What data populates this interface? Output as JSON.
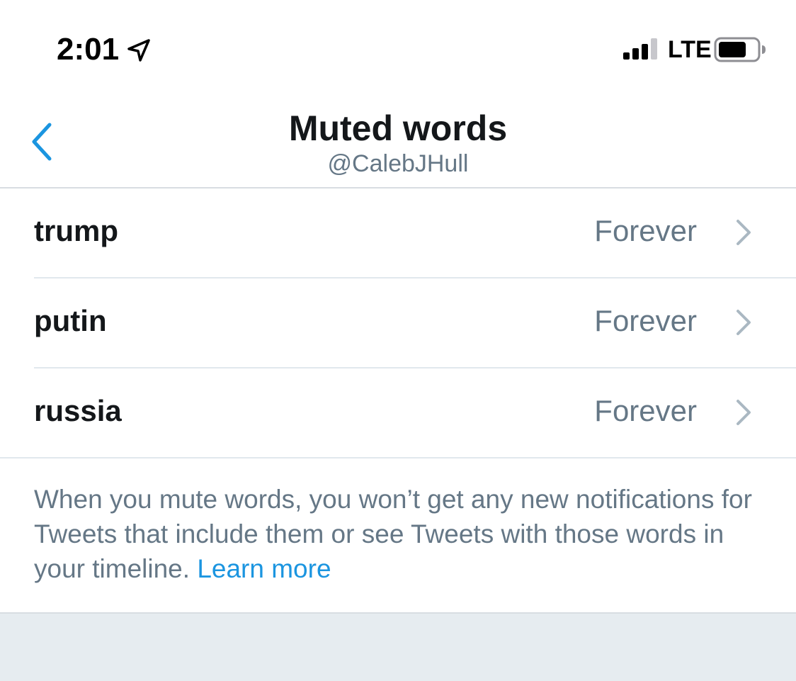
{
  "status_bar": {
    "time": "2:01",
    "network": "LTE",
    "icons": [
      "location-arrow-icon",
      "cellular-signal-icon",
      "battery-icon"
    ]
  },
  "header": {
    "title": "Muted words",
    "subtitle": "@CalebJHull",
    "back_icon": "chevron-left-icon"
  },
  "muted_words": [
    {
      "word": "trump",
      "duration": "Forever"
    },
    {
      "word": "putin",
      "duration": "Forever"
    },
    {
      "word": "russia",
      "duration": "Forever"
    }
  ],
  "explanation": {
    "text": "When you mute words, you won’t get any new notifications for Tweets that include them or see Tweets with those words in your timeline.",
    "link_label": "Learn more"
  },
  "colors": {
    "accent": "#1b95e0",
    "text_primary": "#14171a",
    "text_secondary": "#657786",
    "divider": "#e1e8ed",
    "background_gray": "#e6ecf0"
  }
}
